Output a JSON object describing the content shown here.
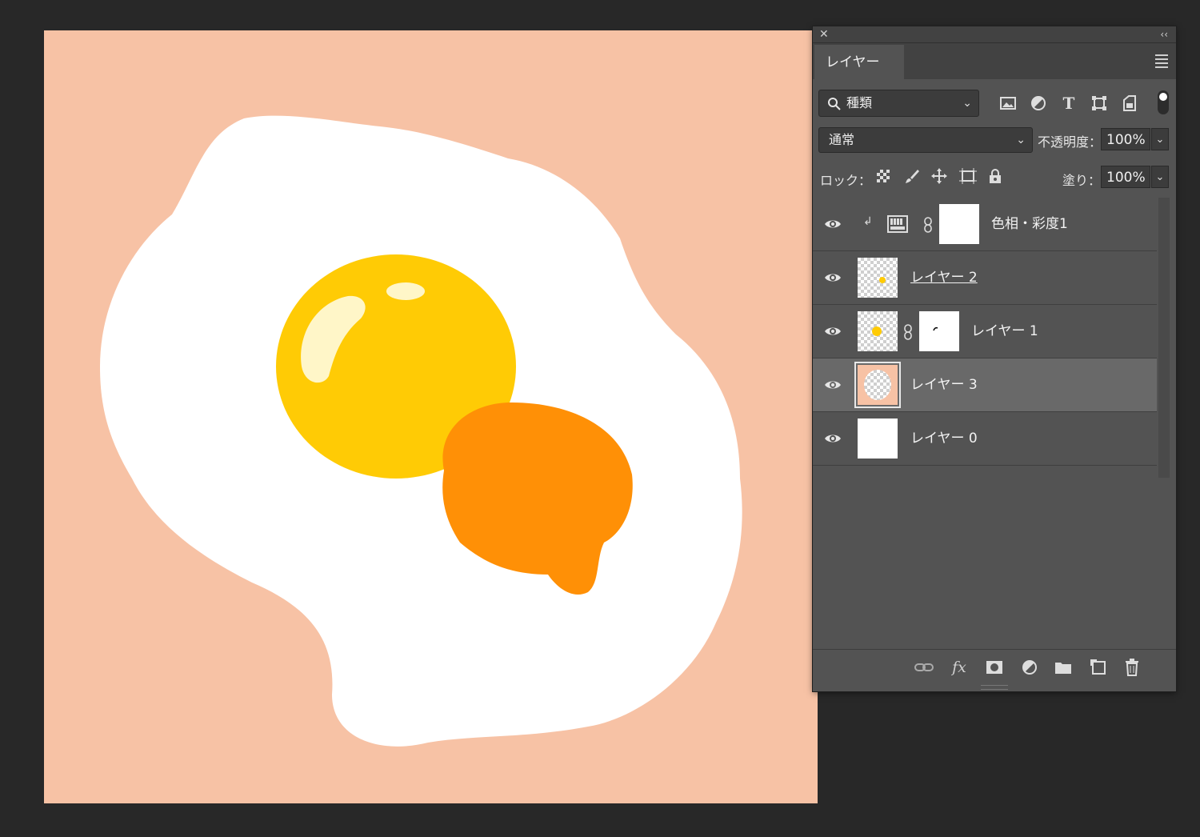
{
  "panel": {
    "tab_label": "レイヤー",
    "filter": {
      "label": "種類"
    },
    "blend_mode": "通常",
    "opacity_label": "不透明度：",
    "opacity_value": "100%",
    "lock_label": "ロック：",
    "fill_label": "塗り：",
    "fill_value": "100%",
    "layers": [
      {
        "name": "色相・彩度1",
        "visible": true,
        "selected": false
      },
      {
        "name": "レイヤー 2",
        "visible": true,
        "selected": false
      },
      {
        "name": "レイヤー 1",
        "visible": true,
        "selected": false
      },
      {
        "name": "レイヤー 3",
        "visible": true,
        "selected": true
      },
      {
        "name": "レイヤー 0",
        "visible": true,
        "selected": false
      }
    ]
  },
  "colors": {
    "background_pink": "#f7c2a5",
    "egg_white": "#ffffff",
    "yolk_yellow": "#ffcb05",
    "yolk_orange": "#ff9006",
    "panel_gray": "#535353",
    "selected_row": "#696969"
  },
  "icons": {
    "filter": [
      "image-filter-icon",
      "adjustment-filter-icon",
      "type-filter-icon",
      "shape-filter-icon",
      "smart-object-filter-icon"
    ],
    "lock": [
      "lock-transparent-pixels-icon",
      "lock-image-pixels-icon",
      "lock-position-icon",
      "lock-artboard-icon",
      "lock-all-icon"
    ],
    "bottom": [
      "link-layers-icon",
      "fx-icon",
      "add-mask-icon",
      "new-adjustment-icon",
      "new-group-icon",
      "new-layer-icon",
      "trash-icon"
    ]
  }
}
